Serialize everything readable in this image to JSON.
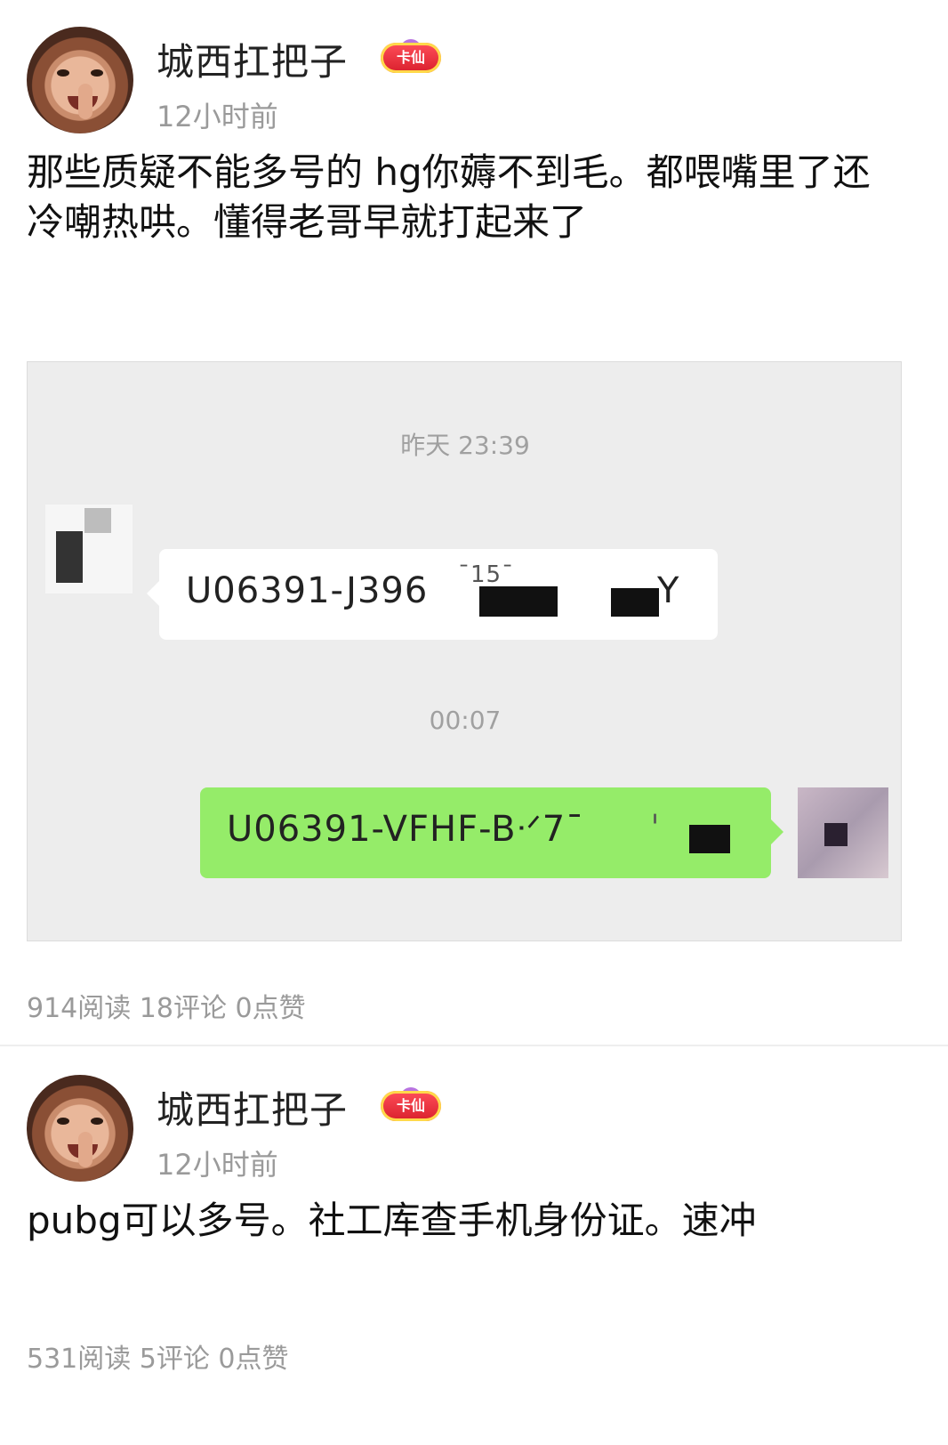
{
  "posts": [
    {
      "username": "城西扛把子",
      "badge": "卡仙",
      "time": "12小时前",
      "content": "那些质疑不能多号的 hg你薅不到毛。都喂嘴里了还冷嘲热哄。懂得老哥早就打起来了",
      "stats": "914阅读 18评论 0点赞"
    },
    {
      "username": "城西扛把子",
      "badge": "卡仙",
      "time": "12小时前",
      "content": "pubg可以多号。社工库查手机身份证。速冲",
      "stats": "531阅读 5评论 0点赞"
    }
  ],
  "chat": {
    "time1": "昨天 23:39",
    "msg1_prefix": "U06391-J396",
    "msg1_frag_a": "ˉ15ˉ",
    "msg1_frag_b": "Y",
    "time2": "00:07",
    "msg2_prefix": "U06391-VFHF-Bᐧᐟ7ˉ",
    "msg2_frag": "ˈ"
  }
}
